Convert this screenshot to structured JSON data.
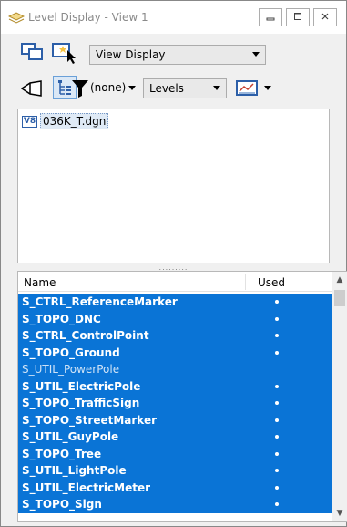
{
  "window": {
    "title": "Level Display - View 1"
  },
  "titlebar": {
    "minimize_icon": "minimize-icon",
    "maximize_icon": "maximize-icon",
    "close_icon": "close-icon"
  },
  "toolbar1": {
    "view_display_value": "View Display"
  },
  "toolbar2": {
    "filter_value": "(none)",
    "levels_value": "Levels"
  },
  "tree": {
    "file_label": "036K_T.dgn",
    "file_badge": "V8"
  },
  "splitter": {
    "grip": "........."
  },
  "list": {
    "columns": [
      "Name",
      "Used"
    ],
    "rows": [
      {
        "name": "S_CTRL_ReferenceMarker",
        "used": true,
        "bold": true
      },
      {
        "name": "S_TOPO_DNC",
        "used": true,
        "bold": true
      },
      {
        "name": "S_CTRL_ControlPoint",
        "used": true,
        "bold": true
      },
      {
        "name": "S_TOPO_Ground",
        "used": true,
        "bold": true
      },
      {
        "name": "S_UTIL_PowerPole",
        "used": false,
        "bold": false
      },
      {
        "name": "S_UTIL_ElectricPole",
        "used": true,
        "bold": true
      },
      {
        "name": "S_TOPO_TrafficSign",
        "used": true,
        "bold": true
      },
      {
        "name": "S_TOPO_StreetMarker",
        "used": true,
        "bold": true
      },
      {
        "name": "S_UTIL_GuyPole",
        "used": true,
        "bold": true
      },
      {
        "name": "S_TOPO_Tree",
        "used": true,
        "bold": true
      },
      {
        "name": "S_UTIL_LightPole",
        "used": true,
        "bold": true
      },
      {
        "name": "S_UTIL_ElectricMeter",
        "used": true,
        "bold": true
      },
      {
        "name": "S_TOPO_Sign",
        "used": true,
        "bold": true
      }
    ]
  },
  "colors": {
    "selection": "#0a74d6",
    "accent": "#2d5fa8"
  }
}
